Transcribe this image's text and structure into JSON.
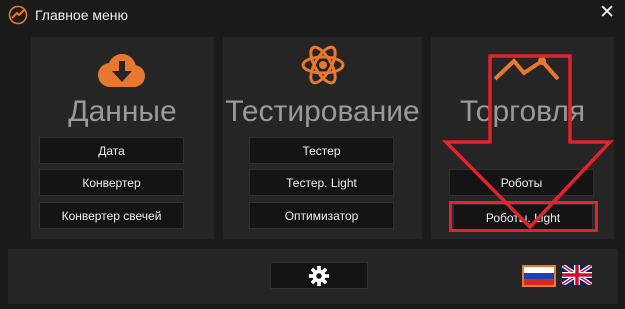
{
  "window": {
    "title": "Главное меню",
    "close_label": "✕"
  },
  "sections": [
    {
      "title": "Данные",
      "buttons": [
        "Дата",
        "Конвертер",
        "Конвертер свечей"
      ]
    },
    {
      "title": "Тестирование",
      "buttons": [
        "Тестер",
        "Тестер. Light",
        "Оптимизатор"
      ]
    },
    {
      "title": "Торговля",
      "buttons": [
        "Роботы",
        "Роботы. Light"
      ]
    }
  ],
  "icons": {
    "app": "app-logo-icon",
    "data": "cloud-download-icon",
    "testing": "atom-icon",
    "trading": "trend-line-icon",
    "settings": "gear-icon"
  },
  "languages": [
    "Russian",
    "English"
  ],
  "colors": {
    "background": "#1b1b1b",
    "panel": "#252525",
    "button": "#141414",
    "accent": "#e8772f",
    "annotation": "#e0232f",
    "section_title": "#9a9a9a"
  }
}
